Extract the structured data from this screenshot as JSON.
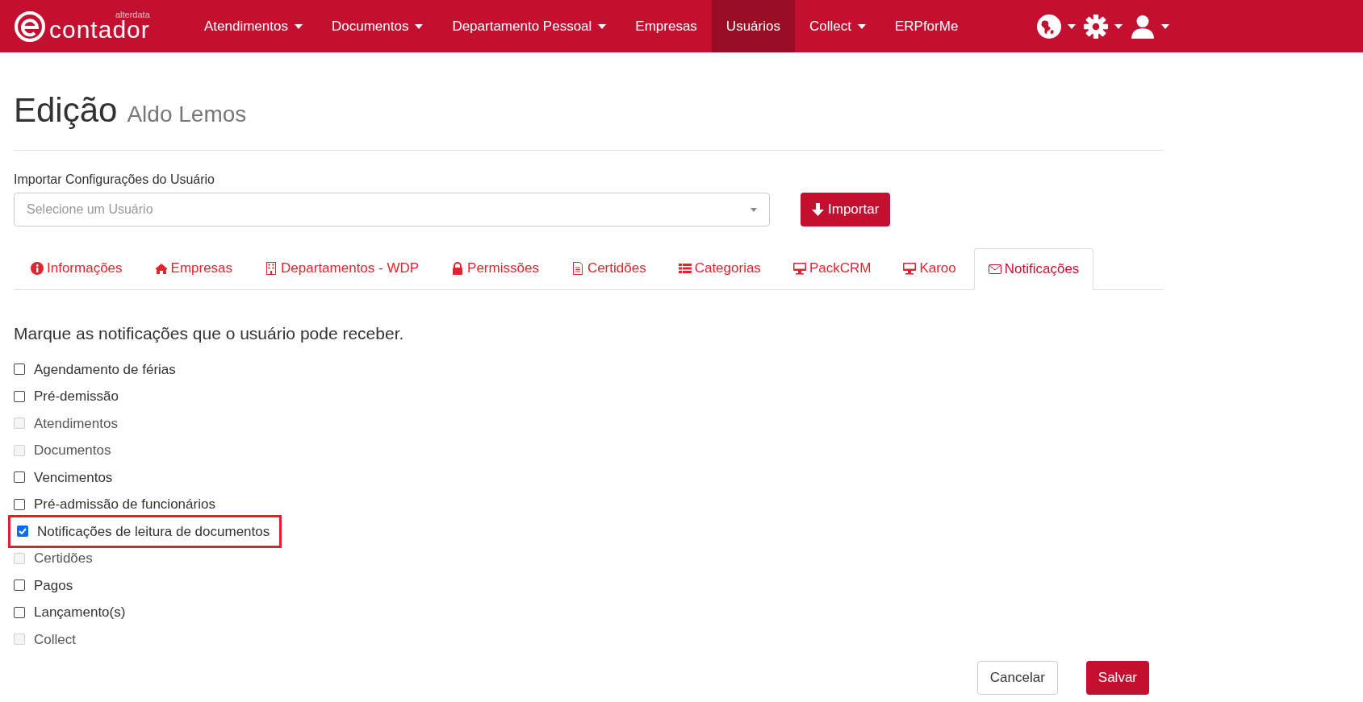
{
  "navbar": {
    "logo": {
      "brand": "alterdata",
      "name": "contador"
    },
    "items": [
      {
        "label": "Atendimentos",
        "dropdown": true,
        "selected": false
      },
      {
        "label": "Documentos",
        "dropdown": true,
        "selected": false
      },
      {
        "label": "Departamento Pessoal",
        "dropdown": true,
        "selected": false
      },
      {
        "label": "Empresas",
        "dropdown": false,
        "selected": false
      },
      {
        "label": "Usuários",
        "dropdown": false,
        "selected": true
      },
      {
        "label": "Collect",
        "dropdown": true,
        "selected": false
      },
      {
        "label": "ERPforMe",
        "dropdown": false,
        "selected": false
      }
    ],
    "icons": [
      {
        "kind": "globe"
      },
      {
        "kind": "gear"
      },
      {
        "kind": "user"
      }
    ]
  },
  "page": {
    "title": "Edição",
    "subtitle": "Aldo Lemos"
  },
  "import": {
    "label": "Importar Configurações do Usuário",
    "placeholder": "Selecione um Usuário",
    "button": "Importar"
  },
  "tabs": [
    {
      "label": "Informações",
      "kind": "info",
      "selected": false
    },
    {
      "label": "Empresas",
      "kind": "home",
      "selected": false
    },
    {
      "label": "Departamentos - WDP",
      "kind": "building",
      "selected": false
    },
    {
      "label": "Permissões",
      "kind": "lock",
      "selected": false
    },
    {
      "label": "Certidões",
      "kind": "file",
      "selected": false
    },
    {
      "label": "Categorias",
      "kind": "list",
      "selected": false
    },
    {
      "label": "PackCRM",
      "kind": "monitor",
      "selected": false
    },
    {
      "label": "Karoo",
      "kind": "monitor",
      "selected": false
    },
    {
      "label": "Notificações",
      "kind": "envelope",
      "selected": true
    }
  ],
  "notifications": {
    "heading": "Marque as notificações que o usuário pode receber.",
    "items": [
      {
        "label": "Agendamento de férias",
        "checked": false,
        "disabled": false,
        "highlighted": false
      },
      {
        "label": "Pré-demissão",
        "checked": false,
        "disabled": false,
        "highlighted": false
      },
      {
        "label": "Atendimentos",
        "checked": false,
        "disabled": true,
        "highlighted": false
      },
      {
        "label": "Documentos",
        "checked": false,
        "disabled": true,
        "highlighted": false
      },
      {
        "label": "Vencimentos",
        "checked": false,
        "disabled": false,
        "highlighted": false
      },
      {
        "label": "Pré-admissão de funcionários",
        "checked": false,
        "disabled": false,
        "highlighted": false
      },
      {
        "label": "Notificações de leitura de documentos",
        "checked": true,
        "disabled": false,
        "highlighted": true
      },
      {
        "label": "Certidões",
        "checked": false,
        "disabled": true,
        "highlighted": false
      },
      {
        "label": "Pagos",
        "checked": false,
        "disabled": false,
        "highlighted": false
      },
      {
        "label": "Lançamento(s)",
        "checked": false,
        "disabled": false,
        "highlighted": false
      },
      {
        "label": "Collect",
        "checked": false,
        "disabled": true,
        "highlighted": false
      }
    ]
  },
  "actions": [
    {
      "label": "Cancelar",
      "kind": "default"
    },
    {
      "label": "Salvar",
      "kind": "primary"
    }
  ]
}
